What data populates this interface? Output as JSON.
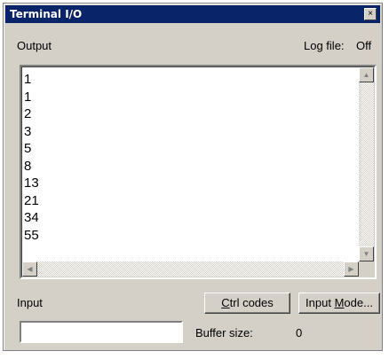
{
  "window": {
    "title": "Terminal I/O",
    "close_glyph": "×"
  },
  "output": {
    "label": "Output",
    "log_file_label": "Log file:",
    "log_file_value": "Off",
    "lines": [
      "1",
      "1",
      "2",
      "3",
      "5",
      "8",
      "13",
      "21",
      "34",
      "55"
    ]
  },
  "input": {
    "label": "Input",
    "value": "",
    "ctrl_codes_prefix": "",
    "ctrl_codes_mnemonic": "C",
    "ctrl_codes_rest": "trl codes",
    "input_mode_prefix": "Input ",
    "input_mode_mnemonic": "M",
    "input_mode_rest": "ode...",
    "buffer_size_label": "Buffer size:",
    "buffer_size_value": "0"
  },
  "scrollbars": {
    "up_arrow": "▲",
    "down_arrow": "▼",
    "left_arrow": "◀",
    "right_arrow": "▶"
  }
}
